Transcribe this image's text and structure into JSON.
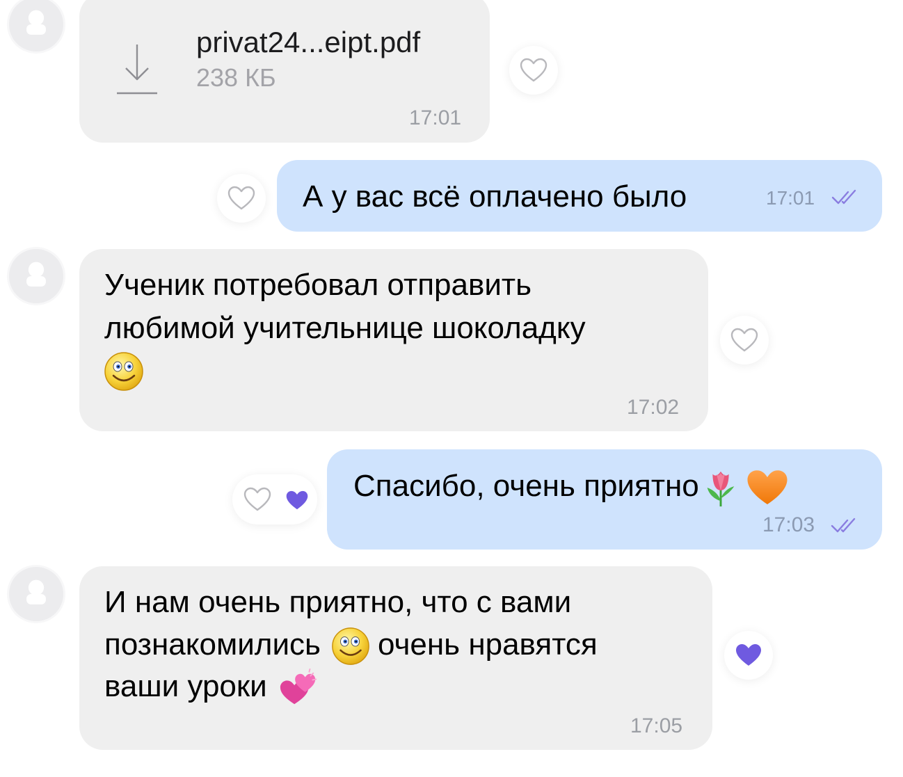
{
  "messages": [
    {
      "kind": "file",
      "file_name": "privat24...eipt.pdf",
      "file_size": "238 КБ",
      "time": "17:01",
      "icon": "download-icon"
    },
    {
      "kind": "outgoing",
      "text": "А у вас всё оплачено было",
      "time": "17:01",
      "status_icon": "double-check-icon"
    },
    {
      "kind": "incoming",
      "line1": "Ученик потребовал отправить",
      "line2": "любимой учительнице шоколадку",
      "emoji": "smiley-face",
      "time": "17:02"
    },
    {
      "kind": "outgoing",
      "text": "Спасибо, очень приятно",
      "emoji": [
        "tulip",
        "orange-heart"
      ],
      "time": "17:03",
      "reaction": "purple-heart",
      "status_icon": "double-check-icon"
    },
    {
      "kind": "incoming",
      "line1": "И нам очень приятно, что с вами",
      "line2a": "познакомились",
      "line2b": "очень нравятся",
      "line3": "ваши уроки",
      "emoji": [
        "smiley-face",
        "two-hearts"
      ],
      "time": "17:05",
      "reaction": "purple-heart"
    }
  ],
  "colors": {
    "incoming_bubble": "#efefef",
    "outgoing_bubble": "#cfe3fd",
    "reaction_heart": "#6f5ae0",
    "timestamp": "#9b9ea4"
  }
}
